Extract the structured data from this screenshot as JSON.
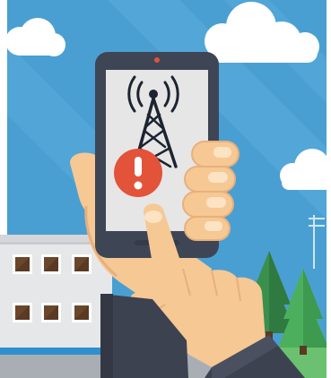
{
  "illustration": {
    "subject": "phone-no-signal-warning",
    "icons": {
      "tower": "cell-tower-icon",
      "alert": "exclamation-icon"
    },
    "colors": {
      "sky": "#4a9fd2",
      "sky_band": "#5aaedc",
      "cloud": "#ffffff",
      "phone_body": "#3e4554",
      "phone_screen": "#e6e6e6",
      "camera_dot": "#e0533c",
      "tower": "#1c2430",
      "alert_circle": "#e2533a",
      "alert_mark": "#ffffff",
      "skin": "#f6c894",
      "skin_shadow": "#e8b07c",
      "sleeve": "#3d4250",
      "building": "#e6e7e8",
      "window": "#5a3a22",
      "tree_dark": "#3b8f4c",
      "tree_light": "#4caf5d",
      "grass": "#6bc16f",
      "water": "#2f8fd0"
    }
  }
}
